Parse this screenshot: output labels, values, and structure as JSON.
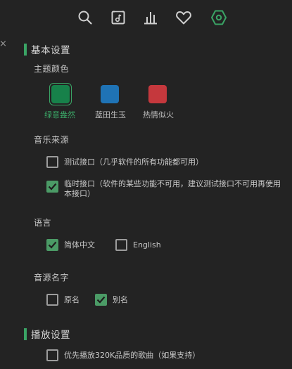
{
  "close_glyph": "×",
  "toolbar": {
    "icons": [
      "search-icon",
      "music-file-icon",
      "bar-chart-icon",
      "heart-icon",
      "settings-hex-icon"
    ],
    "active": "settings-hex-icon"
  },
  "basic": {
    "title": "基本设置",
    "theme": {
      "label": "主题颜色",
      "options": [
        {
          "name": "绿意盎然",
          "color": "#17814a",
          "selected": true
        },
        {
          "name": "蓝田生玉",
          "color": "#1f73b5",
          "selected": false
        },
        {
          "name": "热情似火",
          "color": "#c5383d",
          "selected": false
        }
      ]
    },
    "source": {
      "label": "音乐来源",
      "options": [
        {
          "text": "测试接口（几乎软件的所有功能都可用）",
          "checked": false
        },
        {
          "text_line1": "临时接口（软件的某些功能不可用，建议测试接口不可用再使用",
          "text_line2": "本接口）",
          "checked": true
        }
      ]
    },
    "language": {
      "label": "语言",
      "options": [
        {
          "text": "简体中文",
          "checked": true
        },
        {
          "text": "English",
          "checked": false
        }
      ]
    },
    "source_name": {
      "label": "音源名字",
      "options": [
        {
          "text": "原名",
          "checked": false
        },
        {
          "text": "别名",
          "checked": true
        }
      ]
    }
  },
  "play": {
    "title": "播放设置",
    "options": [
      {
        "text": "优先播放320K品质的歌曲（如果支持）",
        "checked": false
      }
    ]
  },
  "colors": {
    "accent": "#3aa465",
    "check_bg": "#4b9b66",
    "background": "#232323"
  }
}
